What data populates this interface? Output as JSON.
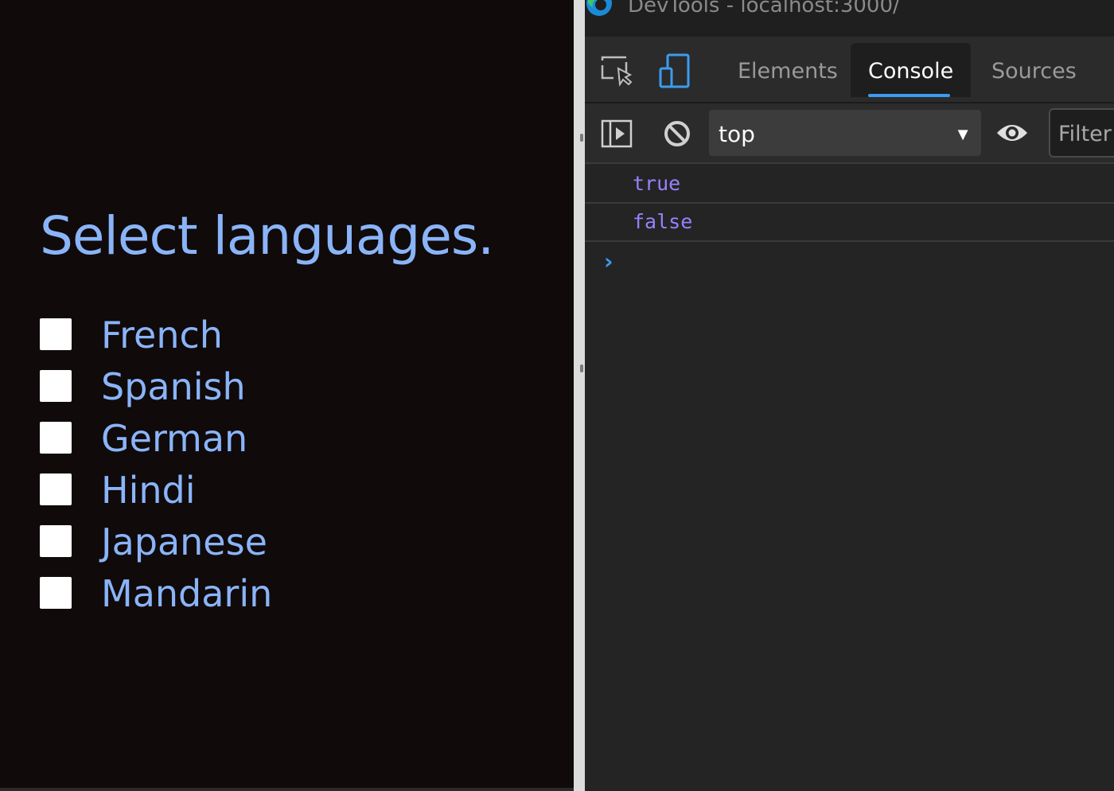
{
  "page": {
    "heading": "Select languages.",
    "languages": [
      "French",
      "Spanish",
      "German",
      "Hindi",
      "Japanese",
      "Mandarin"
    ]
  },
  "devtools": {
    "window_title": "DevTools - localhost:3000/",
    "tabs": [
      {
        "label": "Elements",
        "active": false
      },
      {
        "label": "Console",
        "active": true
      },
      {
        "label": "Sources",
        "active": false
      }
    ],
    "toolbar": {
      "context": "top",
      "filter_placeholder": "Filter"
    },
    "console": {
      "lines": [
        "true",
        "false"
      ],
      "prompt": "›"
    },
    "icons": [
      "edge-logo-icon",
      "inspect-element-icon",
      "device-toolbar-icon",
      "sidebar-toggle-icon",
      "clear-console-icon",
      "dropdown-arrow-icon",
      "live-expression-eye-icon"
    ]
  },
  "colors": {
    "page_background": "#100a0b",
    "page_text": "#8ab4f8",
    "devtools_background": "#242424",
    "accent": "#3b9cf0",
    "console_value": "#9980ff"
  }
}
